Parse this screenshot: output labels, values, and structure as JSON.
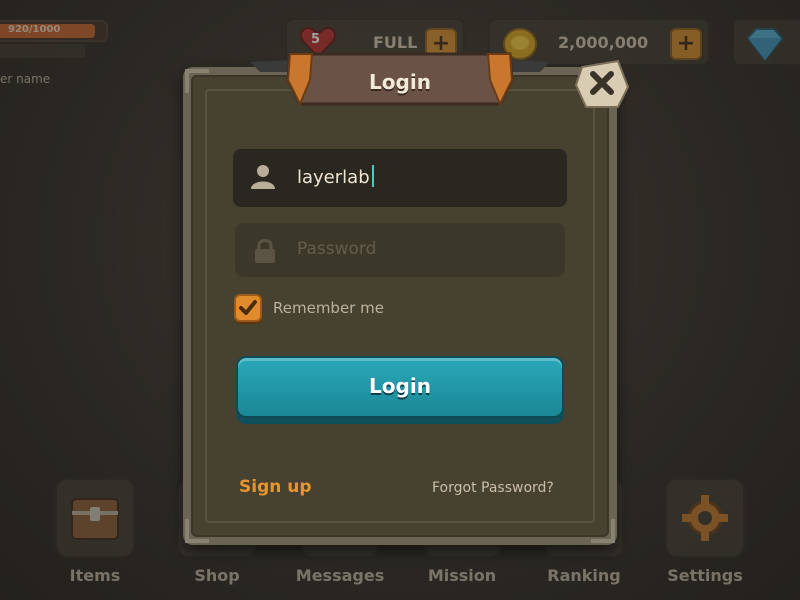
{
  "hud": {
    "xp_text": "920/1000",
    "xp_progress": 0.92,
    "player_name_partial": "er name",
    "hearts_count": "5",
    "hearts_status": "FULL",
    "coins": "2,000,000",
    "plus": "+"
  },
  "nav": [
    {
      "label": "Items",
      "icon": "treasure-chest-icon"
    },
    {
      "label": "Shop",
      "icon": "shop-icon"
    },
    {
      "label": "Messages",
      "icon": "messages-icon"
    },
    {
      "label": "Mission",
      "icon": "mission-icon"
    },
    {
      "label": "Ranking",
      "icon": "ranking-icon"
    },
    {
      "label": "Settings",
      "icon": "gear-icon"
    }
  ],
  "modal": {
    "title": "Login",
    "close_icon": "close-icon",
    "username_value": "layerlab",
    "password_placeholder": "Password",
    "remember_label": "Remember me",
    "remember_checked": true,
    "login_button": "Login",
    "signup_link": "Sign up",
    "forgot_link": "Forgot Password?"
  },
  "colors": {
    "accent_orange": "#e6962e",
    "button_teal": "#1f97a7",
    "panel": "#47412f"
  }
}
